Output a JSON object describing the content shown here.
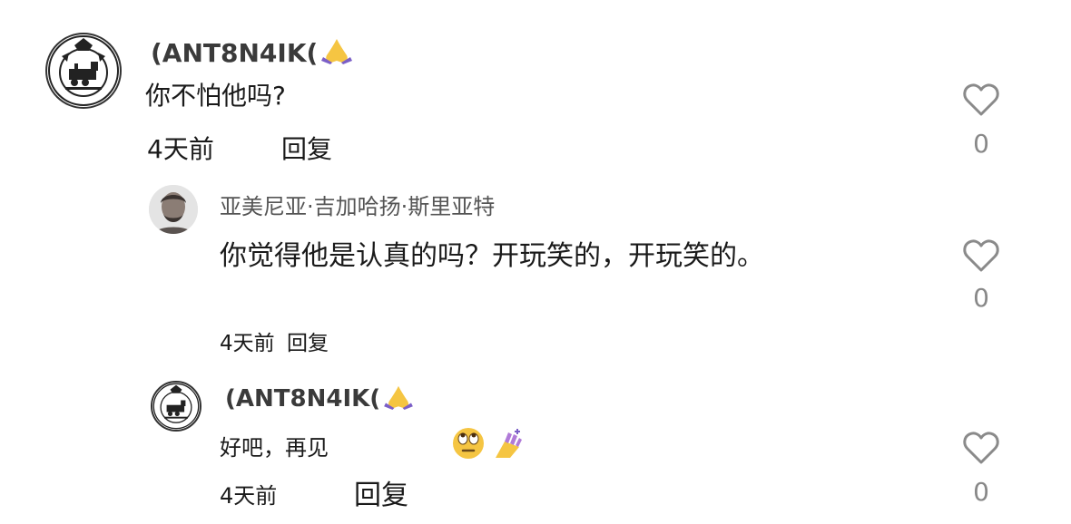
{
  "comments": [
    {
      "username": "(ANT8N4IK(",
      "username_emoji": "pray-emoji",
      "text": "你不怕他吗?",
      "time": "4天前",
      "reply_label": "回复",
      "likes": "0"
    },
    {
      "username": "亚美尼亚·吉加哈扬·斯里亚特",
      "text": "你觉得他是认真的吗？开玩笑的，开玩笑的。",
      "time": "4天前",
      "reply_label": "回复",
      "likes": "0"
    },
    {
      "username": "(ANT8N4IK(",
      "username_emoji": "pray-emoji",
      "text": "好吧，再见",
      "text_emojis": [
        "eye-roll-emoji",
        "nail-polish-emoji"
      ],
      "time": "4天前",
      "reply_label": "回复",
      "likes": "0"
    }
  ],
  "colors": {
    "emoji_purple": "#7b5fc7",
    "emoji_yellow": "#f5c542",
    "heart_stroke": "#8a8a8a"
  }
}
